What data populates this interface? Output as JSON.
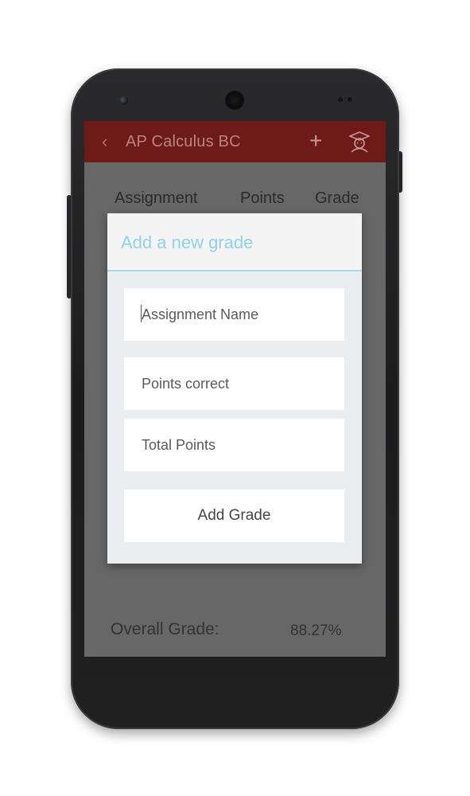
{
  "appbar": {
    "back_icon": "chevron-left-icon",
    "title": "AP Calculus BC",
    "add_icon": "plus-icon",
    "profile_icon": "graduate-icon",
    "color": "#6e1a18"
  },
  "table_header": {
    "assignment": "Assignment",
    "points": "Points",
    "grade": "Grade"
  },
  "footer": {
    "overall_label": "Overall Grade:",
    "overall_value": "88.27%"
  },
  "dialog": {
    "title": "Add a new grade",
    "title_color": "#8fd3e8",
    "assignment_name": {
      "placeholder": "Assignment Name",
      "value": ""
    },
    "points_correct": {
      "placeholder": "Points correct",
      "value": ""
    },
    "total_points": {
      "placeholder": "Total Points",
      "value": ""
    },
    "add_button_label": "Add Grade"
  }
}
